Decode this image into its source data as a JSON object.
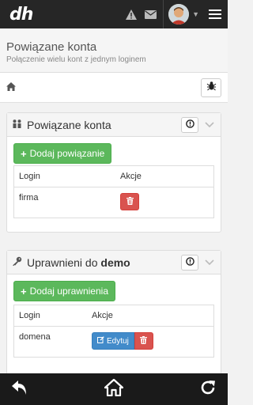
{
  "topbar": {
    "logo": "dh",
    "icons": [
      "warning-icon",
      "envelope-icon",
      "avatar",
      "chevron-down-icon",
      "hamburger-icon"
    ]
  },
  "page": {
    "title": "Powiązane konta",
    "subtitle": "Połączenie wielu kont z jednym loginem"
  },
  "crumbs": {
    "home_icon": "home-icon",
    "bug_icon": "bug-icon"
  },
  "panel1": {
    "title": "Powiązane konta",
    "add_button": "Dodaj powiązanie",
    "table": {
      "headers": [
        "Login",
        "Akcje"
      ],
      "rows": [
        {
          "login": "firma"
        }
      ]
    }
  },
  "panel2": {
    "title_prefix": "Uprawnieni do",
    "title_bold": "demo",
    "add_button": "Dodaj uprawnienia",
    "table": {
      "headers": [
        "Login",
        "Akcje"
      ],
      "rows": [
        {
          "login": "domena",
          "edit": "Edytuj"
        }
      ]
    }
  },
  "colors": {
    "topbar": "#262626",
    "green": "#5cb85c",
    "red": "#d9534f",
    "blue": "#428bca"
  },
  "bottombar": {
    "icons": [
      "back-icon",
      "home-icon",
      "refresh-icon"
    ]
  }
}
